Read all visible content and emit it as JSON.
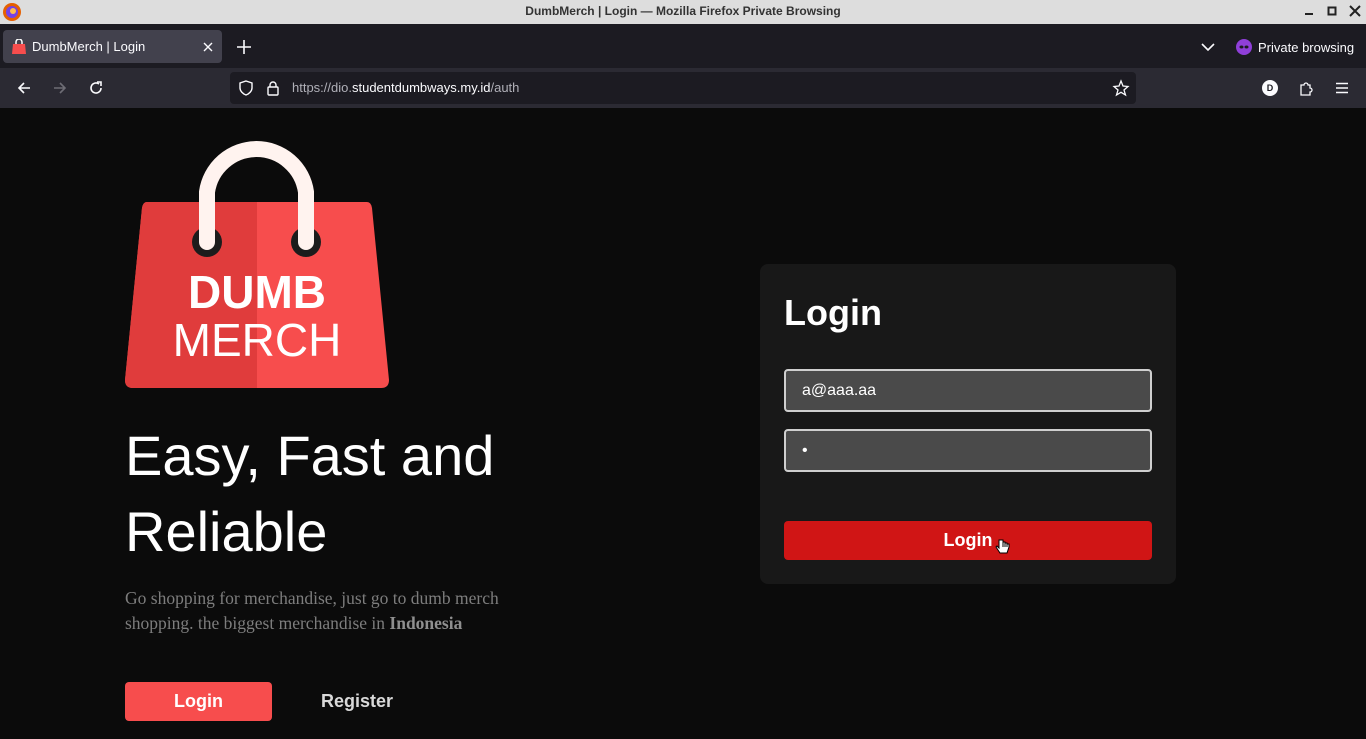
{
  "window": {
    "title": "DumbMerch | Login — Mozilla Firefox Private Browsing"
  },
  "tabs": [
    {
      "label": "DumbMerch | Login",
      "active": true
    }
  ],
  "browser": {
    "private_label": "Private browsing",
    "url_prefix": "https://dio.",
    "url_host": "studentdumbways.my.id",
    "url_path": "/auth",
    "profile_initial": "D"
  },
  "hero": {
    "logo_line1": "DUMB",
    "logo_line2": "MERCH",
    "headline": "Easy, Fast and Reliable",
    "tagline_text": "Go shopping for merchandise, just go to dumb merch shopping. the biggest merchandise in ",
    "tagline_bold": "Indonesia",
    "login_label": "Login",
    "register_label": "Register"
  },
  "login_form": {
    "title": "Login",
    "email_value": "a@aaa.aa",
    "password_value": "•",
    "submit_label": "Login"
  },
  "colors": {
    "brand_red": "#f74d4d",
    "submit_red": "#d01515",
    "background": "#0b0b0b"
  }
}
